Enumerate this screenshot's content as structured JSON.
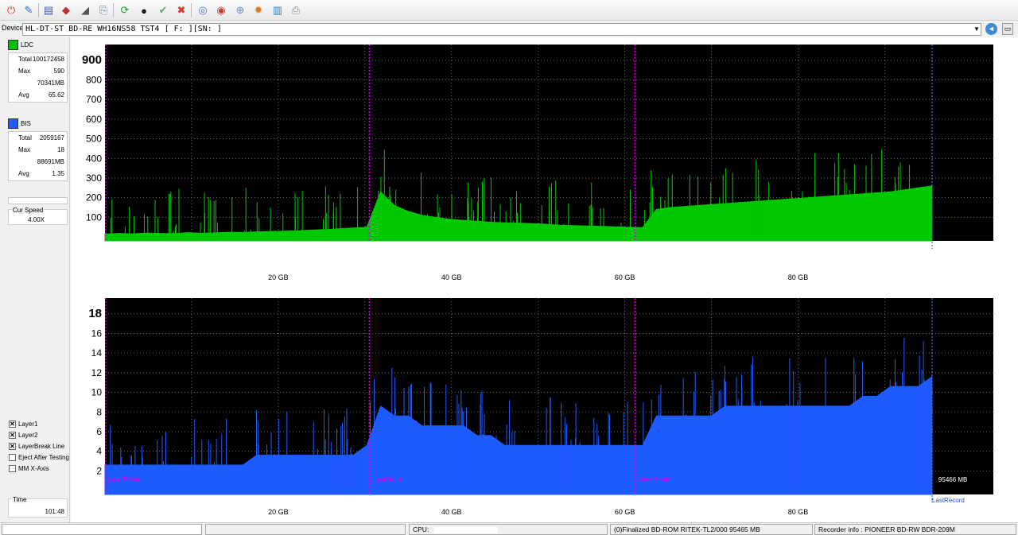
{
  "toolbar": {
    "buttons": [
      {
        "name": "power-icon",
        "glyph": "⏻",
        "color": "#d83a2a"
      },
      {
        "name": "disc-info-icon",
        "glyph": "✎",
        "color": "#2b6fc2"
      },
      {
        "name": "drive-monitor-icon",
        "glyph": "▤",
        "color": "#3a5da8"
      },
      {
        "name": "burn-icon",
        "glyph": "◆",
        "color": "#c22c2c"
      },
      {
        "name": "eraser-icon",
        "glyph": "◢",
        "color": "#555555"
      },
      {
        "name": "copy-icon",
        "glyph": "⎘",
        "color": "#5a7fb0"
      },
      {
        "name": "refresh-icon",
        "glyph": "⟳",
        "color": "#1f9d2e"
      },
      {
        "name": "disc-scan-icon",
        "glyph": "●",
        "color": "#1c1c1c"
      },
      {
        "name": "check-icon",
        "glyph": "✔",
        "color": "#6aa56a"
      },
      {
        "name": "stop-icon",
        "glyph": "✖",
        "color": "#d83a2a"
      },
      {
        "name": "blank-disc-icon",
        "glyph": "◎",
        "color": "#4a79c8"
      },
      {
        "name": "red-disc-icon",
        "glyph": "◉",
        "color": "#c9403a"
      },
      {
        "name": "globe-icon",
        "glyph": "⊕",
        "color": "#6a8ad0"
      },
      {
        "name": "fire-icon",
        "glyph": "✹",
        "color": "#e07a1a"
      },
      {
        "name": "chart-icon",
        "glyph": "▥",
        "color": "#2f7fbf"
      },
      {
        "name": "printer-icon",
        "glyph": "⎙",
        "color": "#8a8a8a"
      }
    ]
  },
  "device": {
    "label": "Device:",
    "value": "HL-DT-ST BD-RE  WH16NS58  TST4 [ F: ][SN:              ]",
    "dropdown_glyph": "▼",
    "btn1_glyph": "◄",
    "btn2_glyph": "▭"
  },
  "ldc": {
    "label": "LDC",
    "color": "#00c000",
    "stats": [
      {
        "k": "Total",
        "v": "100172458"
      },
      {
        "k": "Max",
        "v": "590"
      },
      {
        "k": "",
        "v": "70341MB"
      },
      {
        "k": "Avg",
        "v": "65.62"
      }
    ]
  },
  "bis": {
    "label": "BIS",
    "color": "#1e5bff",
    "stats": [
      {
        "k": "Total",
        "v": "2059167"
      },
      {
        "k": "Max",
        "v": "18"
      },
      {
        "k": "",
        "v": "88691MB"
      },
      {
        "k": "Avg",
        "v": "1.35"
      }
    ]
  },
  "speed": {
    "label": "Cur Speed",
    "value": "4.00X"
  },
  "checkboxes": [
    {
      "label": "Layer1",
      "checked": true
    },
    {
      "label": "Layer2",
      "checked": true
    },
    {
      "label": "LayerBreak Line",
      "checked": true
    },
    {
      "label": "Eject After Testing",
      "checked": false
    },
    {
      "label": "MM X-Axis",
      "checked": false
    }
  ],
  "time": {
    "label": "Time",
    "value": "101:48"
  },
  "chart_data": [
    {
      "type": "area",
      "series": [
        {
          "values": [
            35,
            38,
            36,
            40,
            38,
            37,
            42,
            39,
            41,
            44,
            43,
            46,
            48,
            50,
            52,
            55,
            58,
            62,
            66,
            70,
            250,
            180,
            150,
            130,
            120,
            110,
            105,
            100,
            95,
            92,
            90,
            88,
            85,
            80,
            78,
            76,
            74,
            72,
            70,
            68,
            160,
            170,
            175,
            180,
            185,
            190,
            195,
            200,
            205,
            210,
            215,
            220,
            225,
            230,
            235,
            240,
            245,
            250,
            260,
            270,
            280
          ]
        }
      ],
      "x_range_mb": [
        0,
        95465
      ],
      "xticks": [
        "20 GB",
        "40 GB",
        "60 GB",
        "80 GB"
      ],
      "yticks": [
        "900",
        "800",
        "700",
        "600",
        "500",
        "400",
        "300",
        "200",
        "100"
      ],
      "ylim": [
        0,
        1000
      ],
      "grid": true,
      "colors": {
        "fill": "#00c800",
        "background": "#000000"
      }
    },
    {
      "type": "area",
      "series": [
        {
          "values": [
            3,
            3,
            3,
            3,
            3,
            3,
            3,
            3,
            3,
            3,
            3,
            4,
            4,
            4,
            4,
            4,
            4,
            4,
            4,
            5,
            9,
            8,
            8,
            7,
            7,
            7,
            7,
            6,
            6,
            5,
            5,
            5,
            5,
            5,
            5,
            5,
            5,
            5,
            5,
            5,
            8,
            8,
            8,
            8,
            8,
            9,
            9,
            9,
            9,
            9,
            9,
            9,
            9,
            9,
            9,
            10,
            10,
            11,
            11,
            11,
            12
          ]
        }
      ],
      "x_range_mb": [
        0,
        95465
      ],
      "xticks": [
        "20 GB",
        "40 GB",
        "60 GB",
        "80 GB"
      ],
      "yticks": [
        "18",
        "16",
        "14",
        "12",
        "10",
        "8",
        "6",
        "4",
        "2"
      ],
      "ylim": [
        0,
        20
      ],
      "grid": true,
      "colors": {
        "fill": "#1e5bff",
        "background": "#000000"
      },
      "annotations": [
        "LayerBreak",
        "LayerBreak",
        "LayerBreak",
        "95466 MB",
        "LastRecord"
      ]
    }
  ],
  "layer_breaks": [
    "LayerBreak",
    "LayerBreak",
    "LayerBreak"
  ],
  "status": {
    "cpu_label": "CPU:",
    "disc": "(0)Finalized   BD-ROM   RITEK-TL2/000   95465 MB",
    "recorder": "Recorder info  : PIONEER         BD-RW   BDR-209M"
  }
}
